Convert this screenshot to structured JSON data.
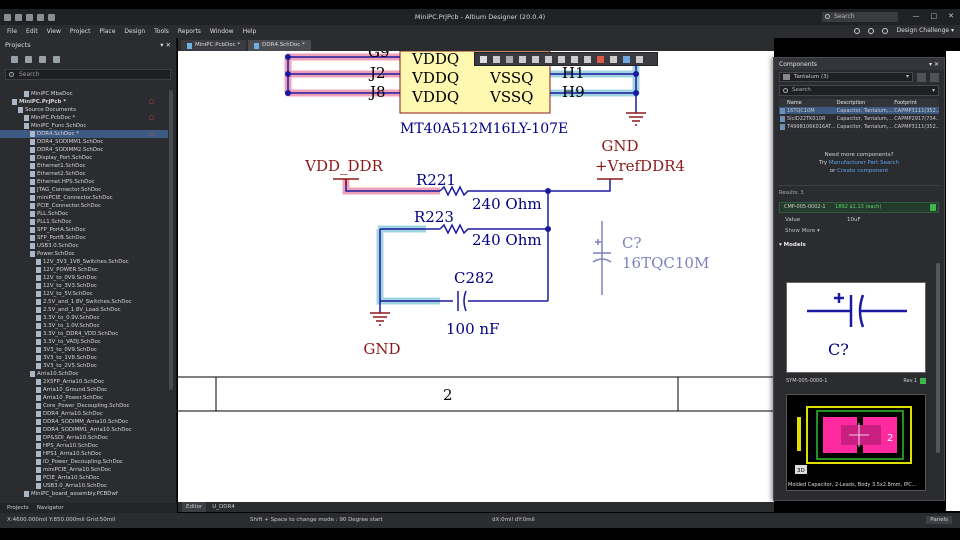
{
  "window": {
    "title": "MiniPC.PrjPcb - Altium Designer (20.0.4)",
    "search_placeholder": "Search",
    "controls": [
      "—",
      "□",
      "✕"
    ]
  },
  "menu": {
    "items": [
      "File",
      "Edit",
      "View",
      "Project",
      "Place",
      "Design",
      "Tools",
      "Reports",
      "Window",
      "Help"
    ],
    "right_label": "Design Challenge ▾"
  },
  "projects_panel": {
    "title": "Projects",
    "controls": "▾ ✕",
    "search_placeholder": "Search",
    "tree": [
      {
        "label": "MiniPC.MbaDoc",
        "indent": 4,
        "mark": ""
      },
      {
        "label": "MiniPC.PrjPcb *",
        "indent": 2,
        "mark": "□",
        "bold": true
      },
      {
        "label": "Source Documents",
        "indent": 3,
        "mark": ""
      },
      {
        "label": "MiniPC.PcbDoc *",
        "indent": 4,
        "mark": "□"
      },
      {
        "label": "MiniPC_Func.SchDoc",
        "indent": 4,
        "mark": ""
      },
      {
        "label": "DDR4.SchDoc *",
        "indent": 5,
        "mark": "□",
        "sel": true
      },
      {
        "label": "DDR4_SODIMM1.SchDoc",
        "indent": 5,
        "mark": ""
      },
      {
        "label": "DDR4_SODIMM2.SchDoc",
        "indent": 5,
        "mark": ""
      },
      {
        "label": "Display_Port.SchDoc",
        "indent": 5,
        "mark": ""
      },
      {
        "label": "Ethernet1.SchDoc",
        "indent": 5,
        "mark": ""
      },
      {
        "label": "Ethernet2.SchDoc",
        "indent": 5,
        "mark": ""
      },
      {
        "label": "Ethernet.HPS.SchDoc",
        "indent": 5,
        "mark": ""
      },
      {
        "label": "JTAG_Connector.SchDoc",
        "indent": 5,
        "mark": ""
      },
      {
        "label": "miniPCIE_Connector.SchDoc",
        "indent": 5,
        "mark": ""
      },
      {
        "label": "PCIE_Connector.SchDoc",
        "indent": 5,
        "mark": ""
      },
      {
        "label": "PLL.SchDoc",
        "indent": 5,
        "mark": ""
      },
      {
        "label": "PLL1.SchDoc",
        "indent": 5,
        "mark": ""
      },
      {
        "label": "SFP_PortA.SchDoc",
        "indent": 5,
        "mark": ""
      },
      {
        "label": "SFP_PortB.SchDoc",
        "indent": 5,
        "mark": ""
      },
      {
        "label": "USB3.0.SchDoc",
        "indent": 5,
        "mark": ""
      },
      {
        "label": "Power.SchDoc",
        "indent": 5,
        "mark": ""
      },
      {
        "label": "12V_3V3_1V8_Switches.SchDoc",
        "indent": 6,
        "mark": ""
      },
      {
        "label": "12V_POWER.SchDoc",
        "indent": 6,
        "mark": ""
      },
      {
        "label": "12V_to_0V9.SchDoc",
        "indent": 6,
        "mark": ""
      },
      {
        "label": "12V_to_3V3.SchDoc",
        "indent": 6,
        "mark": ""
      },
      {
        "label": "12V_to_5V.SchDoc",
        "indent": 6,
        "mark": ""
      },
      {
        "label": "2.5V_and_1.8V_Switches.SchDoc",
        "indent": 6,
        "mark": ""
      },
      {
        "label": "2.5V_and_1.8V_Load.SchDoc",
        "indent": 6,
        "mark": ""
      },
      {
        "label": "3.3V_to_0.9V.SchDoc",
        "indent": 6,
        "mark": ""
      },
      {
        "label": "3.3V_to_1.0V.SchDoc",
        "indent": 6,
        "mark": ""
      },
      {
        "label": "3.3V_to_DDR4_VDD.SchDoc",
        "indent": 6,
        "mark": ""
      },
      {
        "label": "3.3V_to_VADJ.SchDoc",
        "indent": 6,
        "mark": ""
      },
      {
        "label": "3V3_to_0V9.SchDoc",
        "indent": 6,
        "mark": ""
      },
      {
        "label": "3V3_to_1V8.SchDoc",
        "indent": 6,
        "mark": ""
      },
      {
        "label": "3V3_to_2V5.SchDoc",
        "indent": 6,
        "mark": ""
      },
      {
        "label": "Arria10.SchDoc",
        "indent": 5,
        "mark": ""
      },
      {
        "label": "2X5FP_Arria10.SchDoc",
        "indent": 6,
        "mark": ""
      },
      {
        "label": "Arria10_Ground.SchDoc",
        "indent": 6,
        "mark": ""
      },
      {
        "label": "Arria10_Power.SchDoc",
        "indent": 6,
        "mark": ""
      },
      {
        "label": "Core_Power_Decoupling.SchDoc",
        "indent": 6,
        "mark": ""
      },
      {
        "label": "DDR4_Arria10.SchDoc",
        "indent": 6,
        "mark": ""
      },
      {
        "label": "DDR4_SODIMM_Arria10.SchDoc",
        "indent": 6,
        "mark": ""
      },
      {
        "label": "DDR4_SODIMM1_Arria10.SchDoc",
        "indent": 6,
        "mark": ""
      },
      {
        "label": "DP&SDI_Arria10.SchDoc",
        "indent": 6,
        "mark": ""
      },
      {
        "label": "HPS_Arria10.SchDoc",
        "indent": 6,
        "mark": ""
      },
      {
        "label": "HPS1_Arria10.SchDoc",
        "indent": 6,
        "mark": ""
      },
      {
        "label": "IO_Power_Decoupling.SchDoc",
        "indent": 6,
        "mark": ""
      },
      {
        "label": "miniPCIE_Arria10.SchDoc",
        "indent": 6,
        "mark": ""
      },
      {
        "label": "PCIE_Arria10.SchDoc",
        "indent": 6,
        "mark": ""
      },
      {
        "label": "USB3.0_Arria10.SchDoc",
        "indent": 6,
        "mark": ""
      },
      {
        "label": "MiniPC_board_assembly.PCBDwf",
        "indent": 4,
        "mark": ""
      }
    ],
    "tabs": [
      "Projects",
      "Navigator"
    ]
  },
  "doc_tabs": [
    "MiniPC.PcbDoc *",
    "DDR4.SchDoc *"
  ],
  "schematic": {
    "ic_part": "MT40A512M16LY-107E",
    "pins_left": [
      "G9",
      "J2",
      "J8"
    ],
    "pins_left_names": [
      "VDDQ",
      "VDDQ",
      "VDDQ"
    ],
    "pins_right": [
      "H1",
      "H9"
    ],
    "pins_right_names": [
      "VSSQ",
      "VSSQ"
    ],
    "net_vdd": "VDD_DDR",
    "net_vref": "+VrefDDR4",
    "r221": {
      "ref": "R221",
      "value": "240 Ohm"
    },
    "r223": {
      "ref": "R223",
      "value": "240 Ohm"
    },
    "c282": {
      "ref": "C282",
      "value": "100 nF"
    },
    "gnd_top": "GND",
    "gnd_left": "GND",
    "placing_part": {
      "ref": "C?",
      "value": "16TQC10M"
    },
    "border_zone": "2",
    "colors": {
      "wire": "#1a1aa0",
      "part_text": "#000080",
      "net_text": "#8b1a1a",
      "ic_fill": "#fff8b0",
      "hl_pink": "#f0a0b8",
      "hl_cyan": "#9fd4e0"
    }
  },
  "canvas_tabs": [
    "Editor",
    "U_DDR4"
  ],
  "components_panel": {
    "title": "Components",
    "library": "Tantalum",
    "library_count": "(3)",
    "search_placeholder": "Search",
    "columns": [
      "Name",
      "Description",
      "Footprint"
    ],
    "rows": [
      {
        "name": "16TQC10M",
        "desc": "Capacitor, Tantalum,...",
        "fp": "CAPMP3111(352...",
        "sel": true
      },
      {
        "name": "5IcID22TK010R",
        "desc": "Capacitor, Tantalum,...",
        "fp": "CAPMP2917(734...",
        "sel": false
      },
      {
        "name": "T4998106K016AT...",
        "desc": "Capacitor, Tantalum,...",
        "fp": "CAPMP3111(352...",
        "sel": false
      }
    ],
    "need_more": "Need more components?",
    "need_more_try": "Try",
    "need_more_link1": "Manufacturer Part Search",
    "need_more_or": "or",
    "need_more_link2": "Create component",
    "results": "Results: 3",
    "mpn_id": "CMP-005-0002-1",
    "mpn_stock": "1892 $1.13 (each)",
    "param_key": "Value",
    "param_val": "10uF",
    "show_more": "Show More ▾",
    "models_label": "▾ Models",
    "symbol_id": "SYM-005-0000-1",
    "symbol_rev": "Rev.1",
    "symbol_ref": "C?",
    "footprint_desc": "Molded Capacitor, 2-Leads, Body 3.5x2.8mm, IPC...",
    "badge_3d": "3D",
    "pad_num": "2"
  },
  "status": {
    "coords": "X:4600.000mil Y:850.000mil  Grid:50mil",
    "hint": "Shift + Space to change mode : 90 Degree start",
    "delta": "dX:0mil dY:0mil",
    "panels": "Panels"
  }
}
